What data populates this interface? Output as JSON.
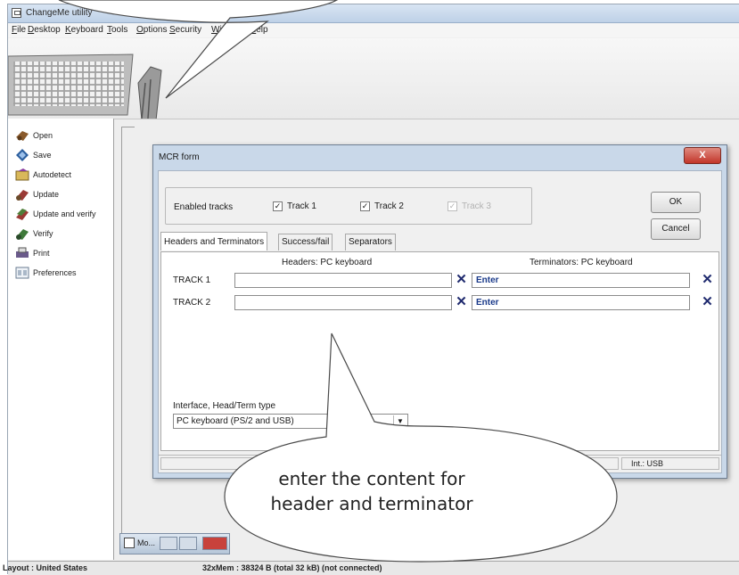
{
  "app": {
    "title": "ChangeMe utility",
    "menu": [
      "File",
      "Desktop",
      "Keyboard",
      "Tools",
      "Options",
      "Security",
      "Window",
      "Help"
    ],
    "sidebar": [
      {
        "label": "Open",
        "icon": "open-icon",
        "color": "#8a5a2b"
      },
      {
        "label": "Save",
        "icon": "save-icon",
        "color": "#2c5f9e"
      },
      {
        "label": "Autodetect",
        "icon": "autodetect-icon",
        "color": "#c8a24a"
      },
      {
        "label": "Update",
        "icon": "update-icon",
        "color": "#9a3a35"
      },
      {
        "label": "Update and verify",
        "icon": "update-verify-icon",
        "color": "#4f7f3a"
      },
      {
        "label": "Verify",
        "icon": "verify-icon",
        "color": "#3f7a3a"
      },
      {
        "label": "Print",
        "icon": "printer-icon",
        "color": "#6a5a8a"
      },
      {
        "label": "Preferences",
        "icon": "preferences-icon",
        "color": "#6a7c92"
      }
    ],
    "status": {
      "layout": "Layout : United States",
      "memory": "32xMem : 38324 B  (total 32 kB) (not connected)"
    },
    "taskbar_label": "Mo..."
  },
  "dialog": {
    "title": "MCR form",
    "enabled_tracks_label": "Enabled tracks",
    "tracks": [
      {
        "label": "Track 1",
        "checked": true,
        "enabled": true
      },
      {
        "label": "Track 2",
        "checked": true,
        "enabled": true
      },
      {
        "label": "Track 3",
        "checked": true,
        "enabled": false
      }
    ],
    "ok_label": "OK",
    "cancel_label": "Cancel",
    "tabs": [
      {
        "label": "Headers and Terminators",
        "active": true
      },
      {
        "label": "Success/fail",
        "active": false
      },
      {
        "label": "Separators",
        "active": false
      }
    ],
    "headers_title": "Headers: PC keyboard",
    "terminators_title": "Terminators: PC keyboard",
    "rows": [
      {
        "label": "TRACK 1",
        "header_value": "",
        "terminator_value": "Enter"
      },
      {
        "label": "TRACK 2",
        "header_value": "",
        "terminator_value": "Enter"
      }
    ],
    "interface_label": "Interface, Head/Term type",
    "interface_value": "PC keyboard (PS/2 and USB)",
    "interface_status": "Int.: USB",
    "close_glyph": "X",
    "clear_glyph": "✕"
  },
  "callout": {
    "text_line1": "enter the content for",
    "text_line2": "header and terminator"
  }
}
